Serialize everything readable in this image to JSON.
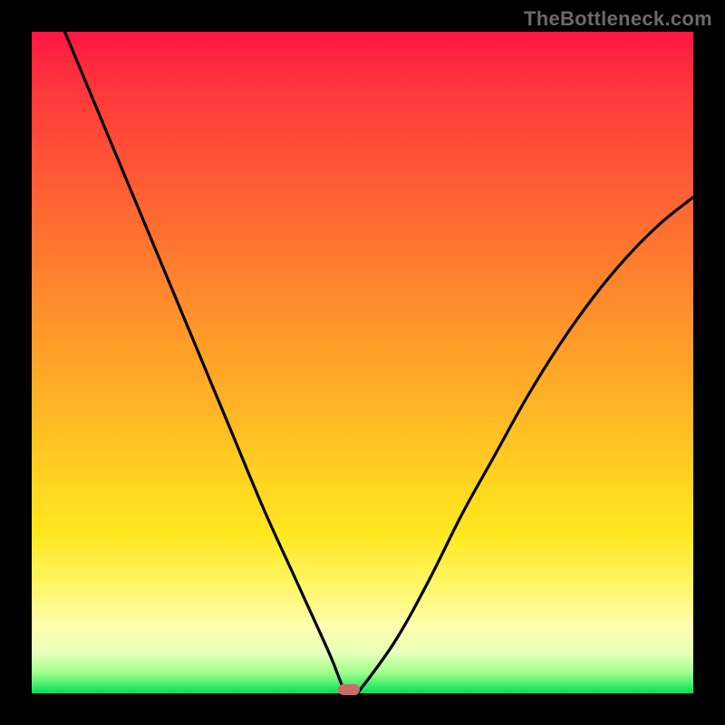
{
  "watermark": "TheBottleneck.com",
  "colors": {
    "frame": "#000000",
    "marker": "#cc6a6a",
    "curve_stroke": "#000000"
  },
  "chart_data": {
    "type": "line",
    "title": "",
    "xlabel": "",
    "ylabel": "",
    "xlim": [
      0,
      100
    ],
    "ylim": [
      0,
      100
    ],
    "grid": false,
    "legend": false,
    "series": [
      {
        "name": "bottleneck-curve",
        "x": [
          5,
          10,
          15,
          20,
          25,
          30,
          35,
          40,
          45,
          47,
          48,
          49,
          50,
          55,
          60,
          65,
          70,
          75,
          80,
          85,
          90,
          95,
          100
        ],
        "y": [
          100,
          88,
          76,
          64,
          52,
          40,
          28,
          17,
          6,
          1,
          0,
          0,
          1,
          8,
          17,
          27,
          36,
          45,
          53,
          60,
          66,
          71,
          75
        ]
      }
    ],
    "annotations": [
      {
        "name": "optimal-marker",
        "x": 48,
        "y": 0
      }
    ]
  }
}
